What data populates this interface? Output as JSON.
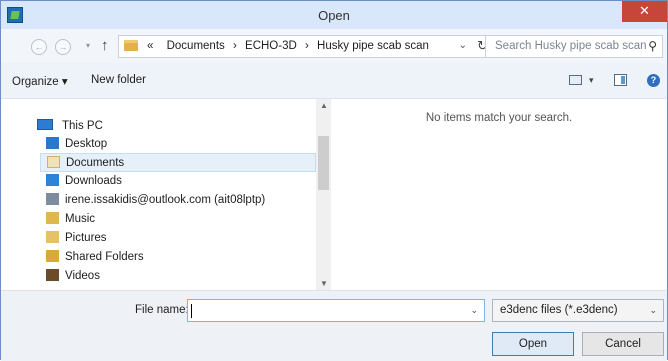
{
  "window": {
    "title": "Open",
    "close_glyph": "✕"
  },
  "nav": {
    "back_glyph": "←",
    "forward_glyph": "→",
    "up_glyph": "↑"
  },
  "address": {
    "overflow": "«",
    "crumbs": [
      "Documents",
      "ECHO-3D",
      "Husky pipe scab scan"
    ],
    "separator": "›",
    "refresh_glyph": "↻"
  },
  "search": {
    "placeholder": "Search Husky pipe scab scan",
    "icon_glyph": "⚲"
  },
  "toolbar": {
    "organize": "Organize ▾",
    "new_folder": "New folder",
    "help": "?"
  },
  "navpane": {
    "this_pc": "This PC",
    "items": [
      {
        "label": "Desktop",
        "icon": "desktop-icon"
      },
      {
        "label": "Documents",
        "icon": "documents-icon",
        "selected": true
      },
      {
        "label": "Downloads",
        "icon": "downloads-icon"
      },
      {
        "label": "irene.issakidis@outlook.com (ait08lptp)",
        "icon": "network-drive-icon"
      },
      {
        "label": "Music",
        "icon": "music-icon"
      },
      {
        "label": "Pictures",
        "icon": "pictures-icon"
      },
      {
        "label": "Shared Folders",
        "icon": "shared-folder-icon"
      },
      {
        "label": "Videos",
        "icon": "videos-icon"
      }
    ]
  },
  "content": {
    "empty_message": "No items match your search."
  },
  "bottom": {
    "file_name_label": "File name:",
    "file_name_value": "",
    "file_type": "e3denc files (*.e3denc)",
    "open_button": "Open",
    "cancel_button": "Cancel"
  },
  "colors": {
    "accent": "#2f6fbf",
    "close": "#c7453a",
    "selection": "#e5f0fb"
  }
}
